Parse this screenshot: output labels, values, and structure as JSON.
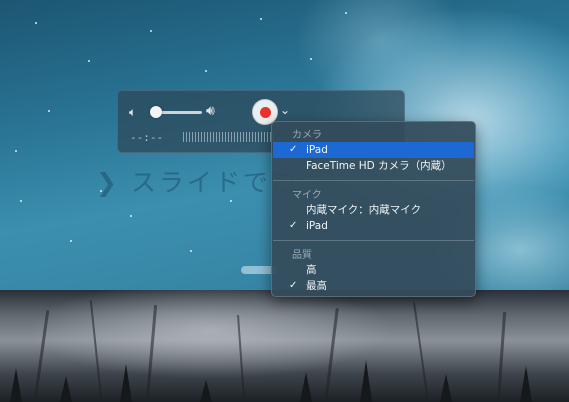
{
  "lock_screen": {
    "slide_text": "❯ スライドでロ"
  },
  "hud": {
    "volume_low_icon": "speaker-low-icon",
    "volume_high_icon": "speaker-high-icon",
    "volume_level": 0.05,
    "record_icon": "record-icon",
    "chevron_icon": "chevron-down-icon",
    "time": "--:--",
    "colors": {
      "record": "#e8322c"
    }
  },
  "menu": {
    "sections": [
      {
        "header": "カメラ",
        "items": [
          {
            "label": "iPad",
            "checked": true,
            "selected": true
          },
          {
            "label": "FaceTime HD カメラ（内蔵）",
            "checked": false,
            "selected": false
          }
        ]
      },
      {
        "header": "マイク",
        "items": [
          {
            "label": "内蔵マイク：内蔵マイク",
            "checked": false,
            "selected": false
          },
          {
            "label": "iPad",
            "checked": true,
            "selected": false
          }
        ]
      },
      {
        "header": "品質",
        "items": [
          {
            "label": "高",
            "checked": false,
            "selected": false
          },
          {
            "label": "最高",
            "checked": true,
            "selected": false
          }
        ]
      }
    ],
    "check_glyph": "✓",
    "colors": {
      "selection": "#1d69d4"
    }
  }
}
